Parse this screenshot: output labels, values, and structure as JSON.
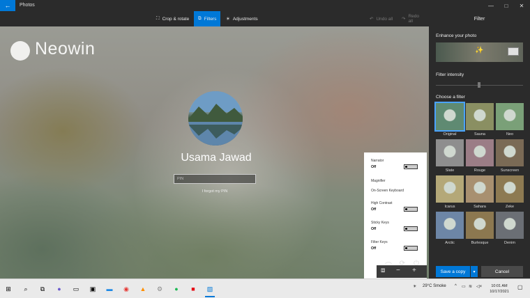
{
  "window": {
    "title": "Photos"
  },
  "toolbar": {
    "crop": "Crop & rotate",
    "filters": "Filters",
    "adjustments": "Adjustments",
    "undo": "Undo all",
    "redo": "Redo all"
  },
  "photo": {
    "logo": "Neowin",
    "lock_screen": {
      "user_name": "Usama Jawad",
      "pin_placeholder": "PIN",
      "forgot_link": "I forgot my PIN"
    },
    "ease_of_access": [
      {
        "label": "Narrator",
        "state": "Off"
      },
      {
        "label": "Magnifier",
        "state": ""
      },
      {
        "label": "On-Screen Keyboard",
        "state": ""
      },
      {
        "label": "High Contrast",
        "state": "Off"
      },
      {
        "label": "Sticky Keys",
        "state": "Off"
      },
      {
        "label": "Filter Keys",
        "state": "Off"
      }
    ]
  },
  "panel": {
    "title": "Filter",
    "enhance_label": "Enhance your photo",
    "intensity_label": "Filter intensity",
    "choose_label": "Choose a filter",
    "filters": [
      {
        "name": "Original",
        "color": "#5f8a72",
        "selected": true
      },
      {
        "name": "Sauna",
        "color": "#8a8f62"
      },
      {
        "name": "Neo",
        "color": "#7aa078"
      },
      {
        "name": "Slate",
        "color": "#8e8e8e"
      },
      {
        "name": "Rouge",
        "color": "#9b7d86"
      },
      {
        "name": "Sunscreen",
        "color": "#7a6a55"
      },
      {
        "name": "Icarus",
        "color": "#b4a878"
      },
      {
        "name": "Sahara",
        "color": "#a89070"
      },
      {
        "name": "Zeke",
        "color": "#8d7a52"
      },
      {
        "name": "Arctic",
        "color": "#6d86a6"
      },
      {
        "name": "Burlesque",
        "color": "#8c7850"
      },
      {
        "name": "Denim",
        "color": "#6b6f75"
      }
    ],
    "save_label": "Save a copy",
    "cancel_label": "Cancel"
  },
  "taskbar": {
    "weather": "29°C  Smoke",
    "time": "10:01 AM",
    "date": "10/17/2021"
  },
  "colors": {
    "accent": "#0078d7",
    "panel_bg": "#2b2b2b"
  }
}
